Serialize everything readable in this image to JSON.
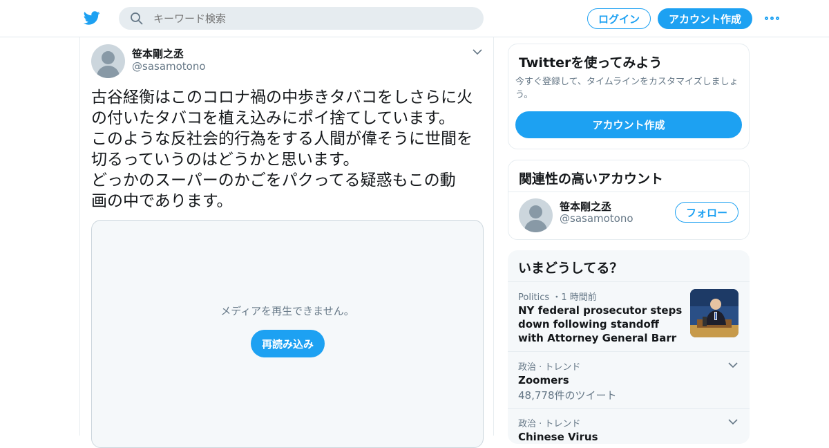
{
  "header": {
    "logo_icon": "twitter-bird-icon",
    "search_placeholder": "キーワード検索",
    "login_label": "ログイン",
    "signup_label": "アカウント作成",
    "more_icon": "more-dots-icon",
    "accent": "#1da1f2"
  },
  "tweet": {
    "author_name": "笹本剛之丞",
    "author_handle": "@sasamotono",
    "text": "古谷経衡はこのコロナ禍の中歩きタバコをしさらに火\nの付いたタバコを植え込みにポイ捨てしています。\nこのような反社会的行為をする人間が偉そうに世間を\n切るっていうのはどうかと思います。\nどっかのスーパーのかごをパクってる疑惑もこの動\n画の中であります。",
    "media_message": "メディアを再生できません。",
    "reload_label": "再読み込み"
  },
  "sidebar": {
    "signup_card": {
      "title": "Twitterを使ってみよう",
      "description": "今すぐ登録して、タイムラインをカスタマイズしましょう。",
      "cta_label": "アカウント作成"
    },
    "related": {
      "title": "関連性の高いアカウント",
      "name": "笹本剛之丞",
      "handle": "@sasamotono",
      "follow_label": "フォロー"
    },
    "trends": {
      "title": "いまどうしてる？",
      "items": [
        {
          "meta": "Politics ・1 時間前",
          "headline": "NY federal prosecutor steps down following standoff with Attorney General Barr",
          "count": ""
        },
        {
          "meta": "政治 · トレンド",
          "headline": "Zoomers",
          "count": "48,778件のツイート"
        },
        {
          "meta": "政治 · トレンド",
          "headline": "Chinese Virus",
          "count": ""
        }
      ]
    }
  }
}
